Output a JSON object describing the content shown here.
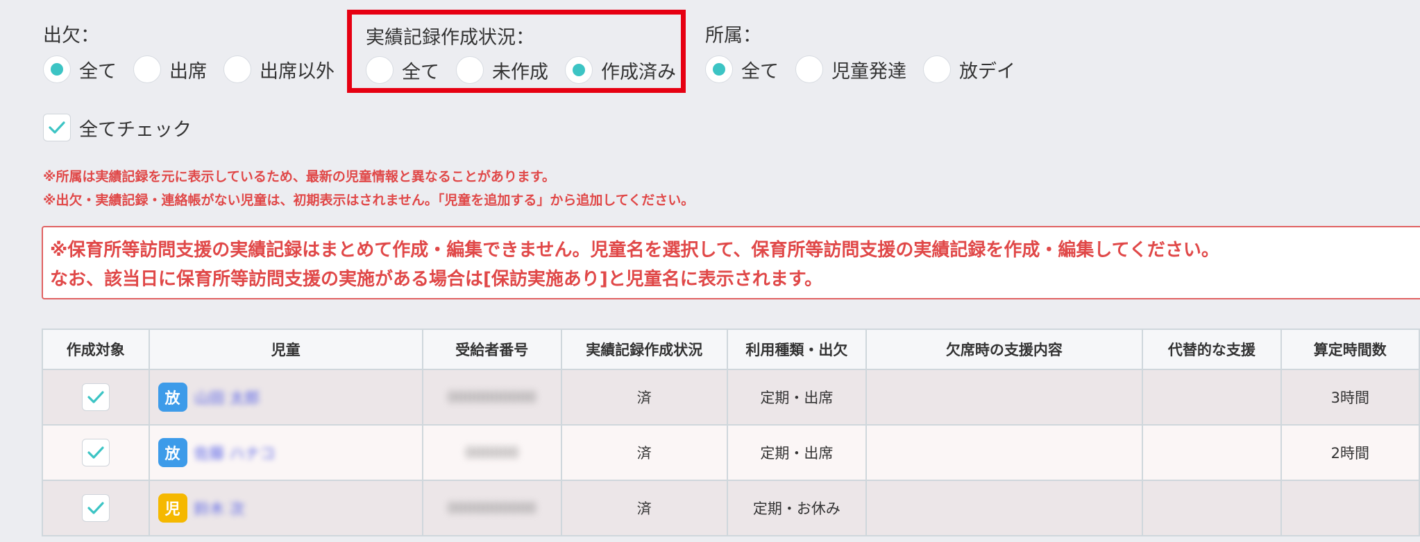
{
  "filters": {
    "attendance": {
      "label": "出欠：",
      "options": [
        {
          "label": "全て",
          "checked": true
        },
        {
          "label": "出席",
          "checked": false
        },
        {
          "label": "出席以外",
          "checked": false
        }
      ]
    },
    "record_status": {
      "label": "実績記録作成状況：",
      "options": [
        {
          "label": "全て",
          "checked": false
        },
        {
          "label": "未作成",
          "checked": false
        },
        {
          "label": "作成済み",
          "checked": true
        }
      ]
    },
    "affiliation": {
      "label": "所属：",
      "options": [
        {
          "label": "全て",
          "checked": true
        },
        {
          "label": "児童発達",
          "checked": false
        },
        {
          "label": "放デイ",
          "checked": false
        }
      ]
    }
  },
  "check_all": {
    "label": "全てチェック",
    "checked": true
  },
  "notes": [
    "※所属は実績記録を元に表示しているため、最新の児童情報と異なることがあります。",
    "※出欠・実績記録・連絡帳がない児童は、初期表示はされません。「児童を追加する」から追加してください。"
  ],
  "alert": {
    "line1": "※保育所等訪問支援の実績記録はまとめて作成・編集できません。児童名を選択して、保育所等訪問支援の実績記録を作成・編集してください。",
    "line2": "なお、該当日に保育所等訪問支援の実施がある場合は[保訪実施あり]と児童名に表示されます。"
  },
  "table": {
    "headers": [
      "作成対象",
      "児童",
      "受給者番号",
      "実績記録作成状況",
      "利用種類・出欠",
      "欠席時の支援内容",
      "代替的な支援",
      "算定時間数"
    ],
    "rows": [
      {
        "checked": true,
        "badge": "放",
        "badge_color": "#3d9be9",
        "child_name": "山田 太郎",
        "recipient_no": "0000000000",
        "status": "済",
        "usage": "定期・出席",
        "absence_support": "",
        "alt_support": "",
        "hours": "3時間"
      },
      {
        "checked": true,
        "badge": "放",
        "badge_color": "#3d9be9",
        "child_name": "佐藤 ハナコ",
        "recipient_no": "000000",
        "status": "済",
        "usage": "定期・出席",
        "absence_support": "",
        "alt_support": "",
        "hours": "2時間"
      },
      {
        "checked": true,
        "badge": "児",
        "badge_color": "#f5b800",
        "child_name": "鈴木 次",
        "recipient_no": "0000000000",
        "status": "済",
        "usage": "定期・お休み",
        "absence_support": "",
        "alt_support": "",
        "hours": ""
      }
    ]
  },
  "colors": {
    "accent": "#3cc4c4",
    "highlight_border": "#e60012",
    "note_red": "#e04848"
  }
}
